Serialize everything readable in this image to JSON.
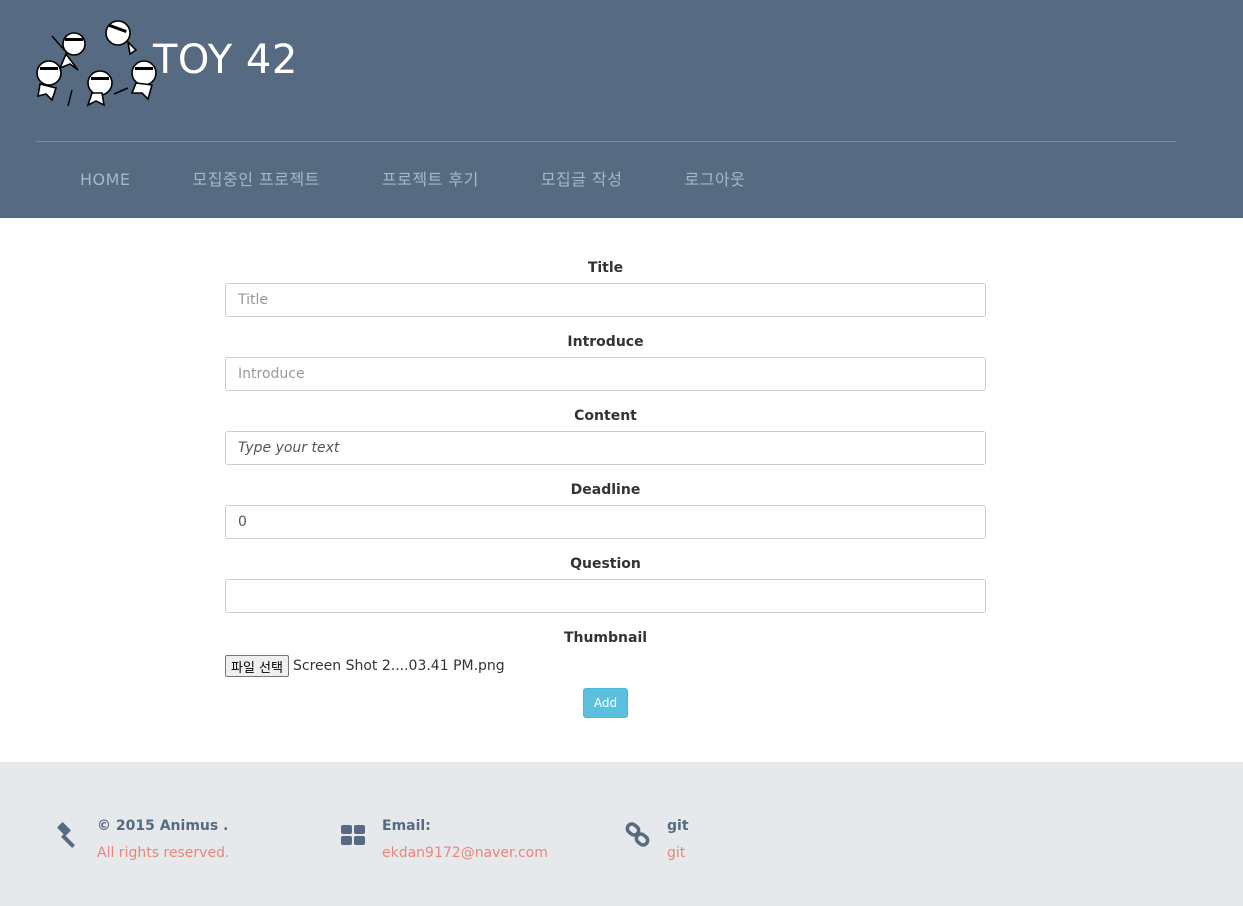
{
  "header": {
    "brand": "TOY 42",
    "bg_color": "#566b82",
    "nav": [
      {
        "label": "HOME"
      },
      {
        "label": "모집중인 프로젝트"
      },
      {
        "label": "프로젝트 후기"
      },
      {
        "label": "모집글 작성"
      },
      {
        "label": "로그아웃"
      }
    ]
  },
  "form": {
    "title": {
      "label": "Title",
      "placeholder": "Title",
      "value": ""
    },
    "introduce": {
      "label": "Introduce",
      "placeholder": "Introduce",
      "value": ""
    },
    "content": {
      "label": "Content",
      "placeholder": "Type your text",
      "value": ""
    },
    "deadline": {
      "label": "Deadline",
      "value": "0"
    },
    "question": {
      "label": "Question",
      "value": ""
    },
    "thumbnail": {
      "label": "Thumbnail",
      "button_label": "파일 선택",
      "file_name": "Screen Shot 2....03.41 PM.png"
    },
    "submit_label": "Add",
    "submit_color": "#5bc0de"
  },
  "footer": {
    "bg_color": "#e6e9ec",
    "columns": [
      {
        "icon": "gavel-icon",
        "title": "© 2015 Animus .",
        "subtitle": "All rights reserved."
      },
      {
        "icon": "grid-icon",
        "title": "Email:",
        "subtitle": "ekdan9172@naver.com"
      },
      {
        "icon": "link-icon",
        "title": "git",
        "subtitle": "git"
      }
    ],
    "accent_color": "#e8867a"
  }
}
